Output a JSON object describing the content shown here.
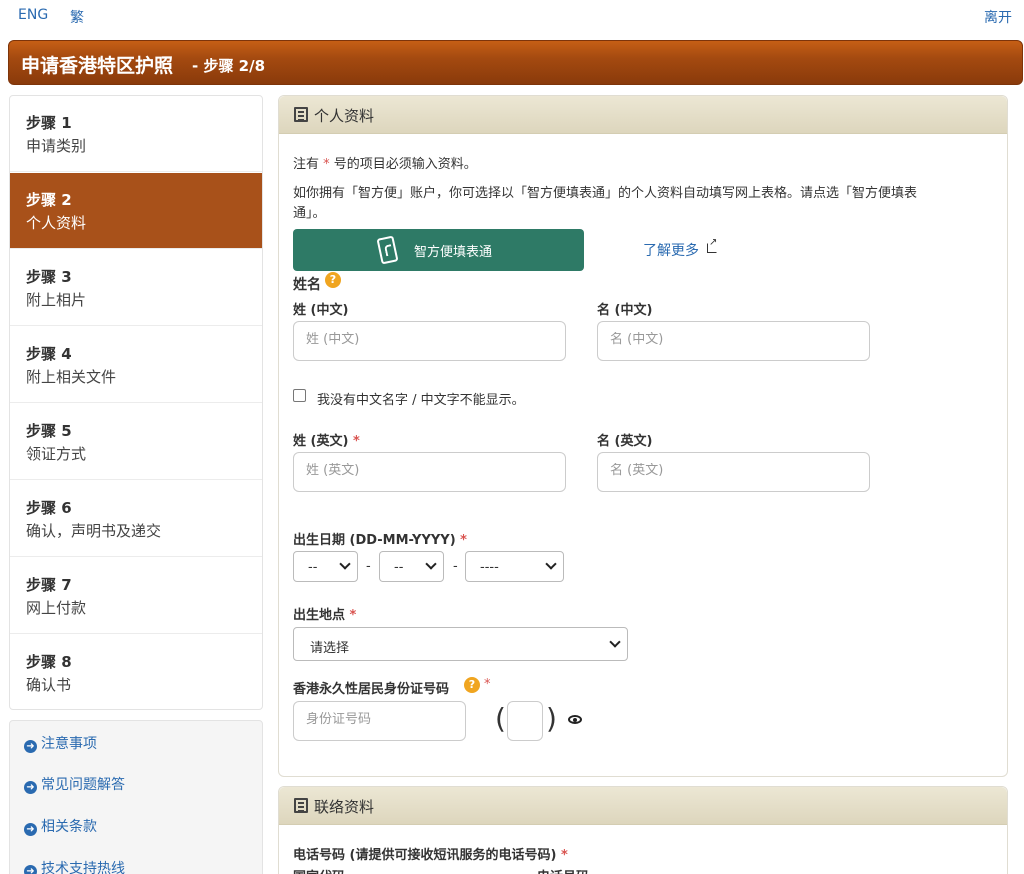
{
  "top_bar": {
    "lang_en": "ENG",
    "lang_trad": "繁",
    "exit": "离开"
  },
  "header": {
    "title": "申请香港特区护照",
    "step": "- 步骤 2/8"
  },
  "steps": [
    {
      "num": "步骤 1",
      "label": "申请类别"
    },
    {
      "num": "步骤 2",
      "label": "个人资料",
      "active": true
    },
    {
      "num": "步骤 3",
      "label": "附上相片"
    },
    {
      "num": "步骤 4",
      "label": "附上相关文件"
    },
    {
      "num": "步骤 5",
      "label": "领证方式"
    },
    {
      "num": "步骤 6",
      "label": "确认，声明书及递交"
    },
    {
      "num": "步骤 7",
      "label": "网上付款"
    },
    {
      "num": "步骤 8",
      "label": "确认书"
    }
  ],
  "side_links": [
    "注意事项",
    "常见问题解答",
    "相关条款",
    "技术支持热线"
  ],
  "personal": {
    "title": "个人资料",
    "note_pre": "注有",
    "note_star": "*",
    "note_post": "号的项目必须输入资料。",
    "iam_desc_1": "如你拥有「智方便」账户，你可选择以「智方便填表通」的个人资料自动填写网上表格。请点选「智方便填表",
    "iam_desc_2": "通」。",
    "iam_button": "智方便填表通",
    "learn_more": "了解更多",
    "name_heading": "姓名",
    "surname_cn_label": "姓 (中文)",
    "surname_cn_placeholder": "姓 (中文)",
    "given_cn_label": "名 (中文)",
    "given_cn_placeholder": "名 (中文)",
    "no_cn_name_label": "我没有中文名字 / 中文字不能显示。",
    "surname_en_label": "姓 (英文)",
    "surname_en_placeholder": "姓 (英文)",
    "given_en_label": "名 (英文)",
    "given_en_placeholder": "名 (英文)",
    "dob_label": "出生日期 (DD-MM-YYYY)",
    "dob_day": "--",
    "dob_month": "--",
    "dob_year": "----",
    "dash": "-",
    "pob_label": "出生地点",
    "pob_value": "请选择",
    "hkid_label": "香港永久性居民身份证号码",
    "hkid_placeholder": "身份证号码",
    "star": "*",
    "help": "?",
    "paren_open": "(",
    "paren_close": ")"
  },
  "contact": {
    "title": "联络资料",
    "phone_label": "电话号码 (请提供可接收短讯服务的电话号码)",
    "area_code_label": "国家代码",
    "phone_no_label": "电话号码"
  }
}
